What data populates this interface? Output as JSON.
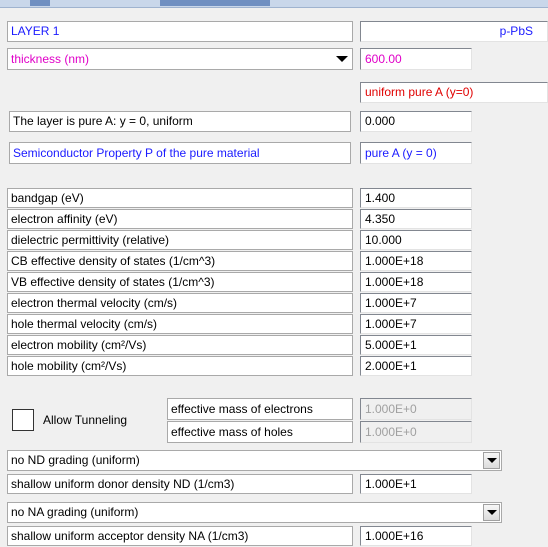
{
  "header": {
    "layer_label": "LAYER 1",
    "layer_name": "p-PbS"
  },
  "thickness": {
    "label": "thickness (nm)",
    "value": "600.00"
  },
  "composition": {
    "mode": "uniform pure A (y=0)",
    "description": "The layer is pure A: y = 0, uniform",
    "y_value": "0.000"
  },
  "property_selector": {
    "label": "Semiconductor Property P of the pure material",
    "value": "pure A (y = 0)"
  },
  "properties": [
    {
      "label": "bandgap (eV)",
      "value": "1.400"
    },
    {
      "label": "electron affinity (eV)",
      "value": "4.350"
    },
    {
      "label": "dielectric permittivity (relative)",
      "value": "10.000"
    },
    {
      "label": "CB effective density of states (1/cm^3)",
      "value": "1.000E+18"
    },
    {
      "label": "VB effective density of states (1/cm^3)",
      "value": "1.000E+18"
    },
    {
      "label": "electron thermal velocity (cm/s)",
      "value": "1.000E+7"
    },
    {
      "label": "hole thermal velocity (cm/s)",
      "value": "1.000E+7"
    },
    {
      "label": "electron mobility (cm²/Vs)",
      "value": "5.000E+1"
    },
    {
      "label": "hole mobility (cm²/Vs)",
      "value": "2.000E+1"
    }
  ],
  "tunneling": {
    "checkbox_label": "Allow Tunneling",
    "electron_mass_label": "effective mass of electrons",
    "electron_mass_value": "1.000E+0",
    "hole_mass_label": "effective mass of holes",
    "hole_mass_value": "1.000E+0"
  },
  "donor": {
    "grading": "no ND grading (uniform)",
    "label": "shallow uniform donor density ND (1/cm3)",
    "value": "1.000E+1"
  },
  "acceptor": {
    "grading": "no NA grading (uniform)",
    "label": "shallow uniform acceptor density NA (1/cm3)",
    "value": "1.000E+16"
  }
}
